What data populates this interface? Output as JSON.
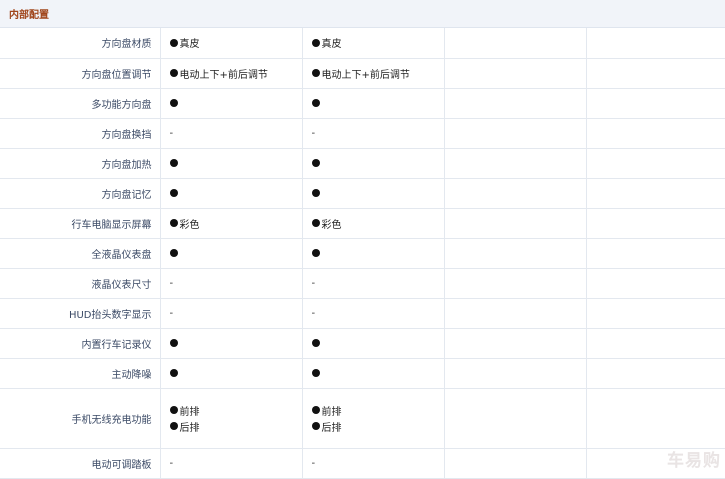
{
  "section": {
    "title": "内部配置"
  },
  "watermark": "车易购",
  "rows": [
    {
      "label": "方向盘材质",
      "cols": [
        [
          {
            "dot": true,
            "text": "真皮"
          }
        ],
        [
          {
            "dot": true,
            "text": "真皮"
          }
        ],
        [],
        []
      ]
    },
    {
      "label": "方向盘位置调节",
      "cols": [
        [
          {
            "dot": true,
            "text": "电动上下+前后调节"
          }
        ],
        [
          {
            "dot": true,
            "text": "电动上下+前后调节"
          }
        ],
        [],
        []
      ]
    },
    {
      "label": "多功能方向盘",
      "cols": [
        [
          {
            "dot": true,
            "text": ""
          }
        ],
        [
          {
            "dot": true,
            "text": ""
          }
        ],
        [],
        []
      ]
    },
    {
      "label": "方向盘换挡",
      "cols": [
        [
          {
            "dot": false,
            "text": "-"
          }
        ],
        [
          {
            "dot": false,
            "text": "-"
          }
        ],
        [],
        []
      ]
    },
    {
      "label": "方向盘加热",
      "cols": [
        [
          {
            "dot": true,
            "text": ""
          }
        ],
        [
          {
            "dot": true,
            "text": ""
          }
        ],
        [],
        []
      ]
    },
    {
      "label": "方向盘记忆",
      "cols": [
        [
          {
            "dot": true,
            "text": ""
          }
        ],
        [
          {
            "dot": true,
            "text": ""
          }
        ],
        [],
        []
      ]
    },
    {
      "label": "行车电脑显示屏幕",
      "cols": [
        [
          {
            "dot": true,
            "text": "彩色"
          }
        ],
        [
          {
            "dot": true,
            "text": "彩色"
          }
        ],
        [],
        []
      ]
    },
    {
      "label": "全液晶仪表盘",
      "cols": [
        [
          {
            "dot": true,
            "text": ""
          }
        ],
        [
          {
            "dot": true,
            "text": ""
          }
        ],
        [],
        []
      ]
    },
    {
      "label": "液晶仪表尺寸",
      "cols": [
        [
          {
            "dot": false,
            "text": "-"
          }
        ],
        [
          {
            "dot": false,
            "text": "-"
          }
        ],
        [],
        []
      ]
    },
    {
      "label": "HUD抬头数字显示",
      "cols": [
        [
          {
            "dot": false,
            "text": "-"
          }
        ],
        [
          {
            "dot": false,
            "text": "-"
          }
        ],
        [],
        []
      ]
    },
    {
      "label": "内置行车记录仪",
      "cols": [
        [
          {
            "dot": true,
            "text": ""
          }
        ],
        [
          {
            "dot": true,
            "text": ""
          }
        ],
        [],
        []
      ]
    },
    {
      "label": "主动降噪",
      "cols": [
        [
          {
            "dot": true,
            "text": ""
          }
        ],
        [
          {
            "dot": true,
            "text": ""
          }
        ],
        [],
        []
      ]
    },
    {
      "label": "手机无线充电功能",
      "tall": true,
      "cols": [
        [
          {
            "dot": true,
            "text": "前排"
          },
          {
            "dot": true,
            "text": "后排"
          }
        ],
        [
          {
            "dot": true,
            "text": "前排"
          },
          {
            "dot": true,
            "text": "后排"
          }
        ],
        [],
        []
      ]
    },
    {
      "label": "电动可调踏板",
      "cols": [
        [
          {
            "dot": false,
            "text": "-"
          }
        ],
        [
          {
            "dot": false,
            "text": "-"
          }
        ],
        [],
        []
      ]
    }
  ]
}
